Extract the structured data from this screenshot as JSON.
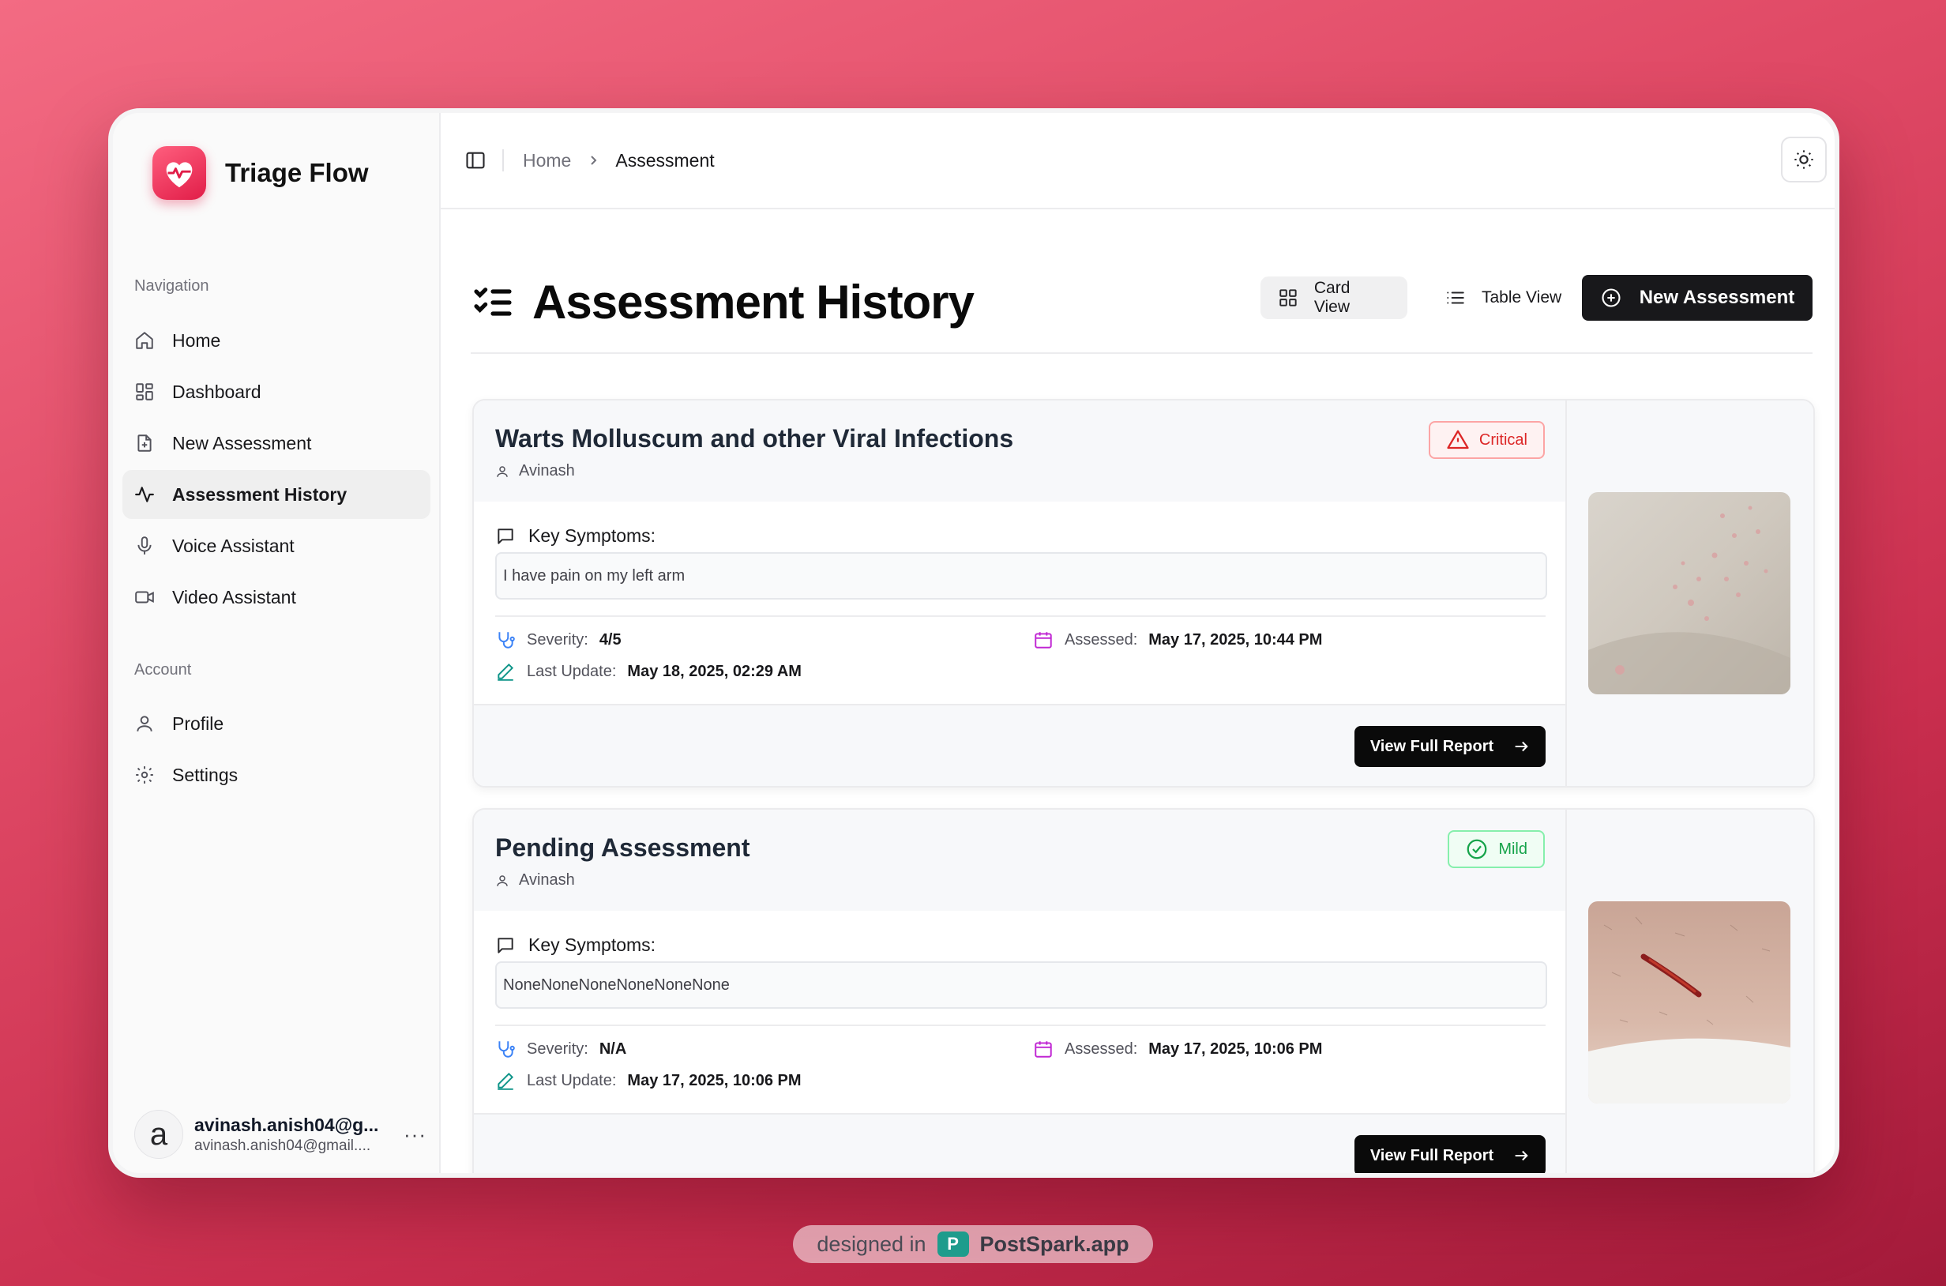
{
  "app": {
    "name": "Triage Flow"
  },
  "sidebar": {
    "navigation_label": "Navigation",
    "items": [
      {
        "label": "Home",
        "icon": "home-icon"
      },
      {
        "label": "Dashboard",
        "icon": "dashboard-icon"
      },
      {
        "label": "New Assessment",
        "icon": "file-plus-icon"
      },
      {
        "label": "Assessment History",
        "icon": "activity-icon",
        "active": true
      },
      {
        "label": "Voice Assistant",
        "icon": "mic-icon"
      },
      {
        "label": "Video Assistant",
        "icon": "video-icon"
      }
    ],
    "account_label": "Account",
    "account_items": [
      {
        "label": "Profile",
        "icon": "user-icon"
      },
      {
        "label": "Settings",
        "icon": "gear-icon"
      }
    ],
    "user": {
      "initial": "a",
      "name": "avinash.anish04@g...",
      "email": "avinash.anish04@gmail...."
    }
  },
  "topbar": {
    "breadcrumb": [
      "Home",
      "Assessment"
    ]
  },
  "page": {
    "title": "Assessment History",
    "card_view_label": "Card View",
    "table_view_label": "Table View",
    "new_button_label": "New Assessment"
  },
  "assessments": [
    {
      "title": "Warts Molluscum and other Viral Infections",
      "user": "Avinash",
      "badge": "Critical",
      "symptoms_label": "Key Symptoms:",
      "symptoms": "I have pain on my left arm",
      "severity_label": "Severity:",
      "severity": "4/5",
      "assessed_label": "Assessed:",
      "assessed": "May 17, 2025, 10:44 PM",
      "update_label": "Last Update:",
      "updated": "May 18, 2025, 02:29 AM",
      "report_label": "View Full Report"
    },
    {
      "title": "Pending Assessment",
      "user": "Avinash",
      "badge": "Mild",
      "symptoms_label": "Key Symptoms:",
      "symptoms": "NoneNoneNoneNoneNoneNone",
      "severity_label": "Severity:",
      "severity": "N/A",
      "assessed_label": "Assessed:",
      "assessed": "May 17, 2025, 10:06 PM",
      "update_label": "Last Update:",
      "updated": "May 17, 2025, 10:06 PM",
      "report_label": "View Full Report"
    }
  ],
  "footer": {
    "prefix": "designed in",
    "brand": "PostSpark.app",
    "logo_letter": "P"
  },
  "colors": {
    "accent": "#18181b",
    "critical": "#dc2626",
    "mild": "#16a34a",
    "brand": "#e11d48"
  }
}
